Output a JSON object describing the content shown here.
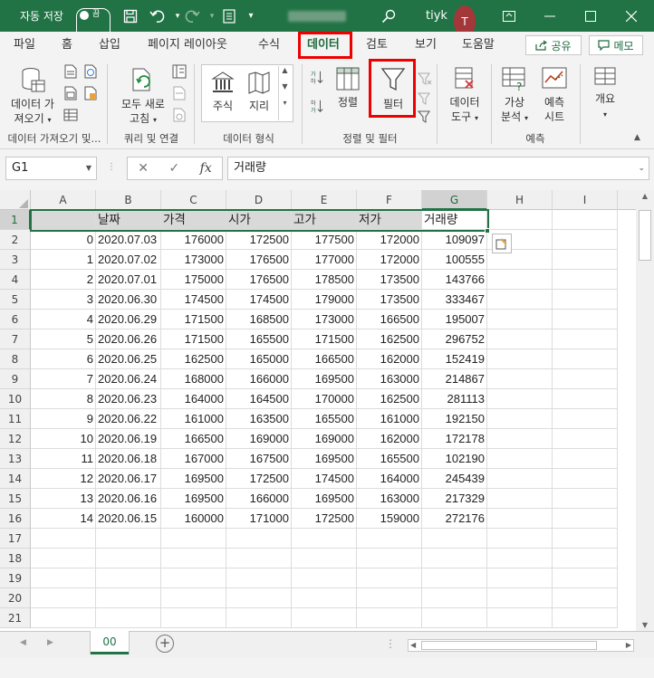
{
  "titlebar": {
    "autosave_label": "자동 저장",
    "autosave_state": "끔",
    "user_name": "tiyk",
    "avatar_initial": "T",
    "icons": [
      "save-icon",
      "undo-icon",
      "redo-icon",
      "customize-qat-icon",
      "search-icon",
      "ribbon-display-icon",
      "minimize-icon",
      "restore-icon",
      "close-icon"
    ]
  },
  "tabs": [
    "파일",
    "홈",
    "삽입",
    "페이지 레이아웃",
    "수식",
    "데이터",
    "검토",
    "보기",
    "도움말"
  ],
  "active_tab": "데이터",
  "share_label": "공유",
  "comments_label": "메모",
  "ribbon": {
    "get_data": "데이터 가\n져오기",
    "refresh_all": "모두 새로\n고침",
    "stocks": "주식",
    "geography": "지리",
    "sort": "정렬",
    "filter": "필터",
    "data_tools": "데이터\n도구",
    "what_if": "가상\n분석",
    "forecast_sheet": "예측\n시트",
    "outline": "개요",
    "groups": {
      "get_transform": "데이터 가져오기 및...",
      "queries": "쿼리 및 연결",
      "data_types": "데이터 형식",
      "sort_filter": "정렬 및 필터",
      "forecast": "예측"
    }
  },
  "formula": {
    "name_box": "G1",
    "fx": "fx",
    "content": "거래량"
  },
  "grid": {
    "columns": [
      "A",
      "B",
      "C",
      "D",
      "E",
      "F",
      "G",
      "H",
      "I"
    ],
    "headers": [
      "",
      "날짜",
      "가격",
      "시가",
      "고가",
      "저가",
      "거래량"
    ],
    "rows": [
      [
        "0",
        "2020.07.03",
        "176000",
        "172500",
        "177500",
        "172000",
        "109097"
      ],
      [
        "1",
        "2020.07.02",
        "173000",
        "176500",
        "177000",
        "172000",
        "100555"
      ],
      [
        "2",
        "2020.07.01",
        "175000",
        "176500",
        "178500",
        "173500",
        "143766"
      ],
      [
        "3",
        "2020.06.30",
        "174500",
        "174500",
        "179000",
        "173500",
        "333467"
      ],
      [
        "4",
        "2020.06.29",
        "171500",
        "168500",
        "173000",
        "166500",
        "195007"
      ],
      [
        "5",
        "2020.06.26",
        "171500",
        "165500",
        "171500",
        "162500",
        "296752"
      ],
      [
        "6",
        "2020.06.25",
        "162500",
        "165000",
        "166500",
        "162000",
        "152419"
      ],
      [
        "7",
        "2020.06.24",
        "168000",
        "166000",
        "169500",
        "163000",
        "214867"
      ],
      [
        "8",
        "2020.06.23",
        "164000",
        "164500",
        "170000",
        "162500",
        "281113"
      ],
      [
        "9",
        "2020.06.22",
        "161000",
        "163500",
        "165500",
        "161000",
        "192150"
      ],
      [
        "10",
        "2020.06.19",
        "166500",
        "169000",
        "169000",
        "162000",
        "172178"
      ],
      [
        "11",
        "2020.06.18",
        "167000",
        "167500",
        "169500",
        "165500",
        "102190"
      ],
      [
        "12",
        "2020.06.17",
        "169500",
        "172500",
        "174500",
        "164000",
        "245439"
      ],
      [
        "13",
        "2020.06.16",
        "169500",
        "166000",
        "169500",
        "163000",
        "217329"
      ],
      [
        "14",
        "2020.06.15",
        "160000",
        "171000",
        "172500",
        "159000",
        "272176"
      ]
    ],
    "total_rows_shown": 21
  },
  "sheets": [
    "00"
  ],
  "colors": {
    "accent": "#217346",
    "highlight": "#e00000"
  }
}
